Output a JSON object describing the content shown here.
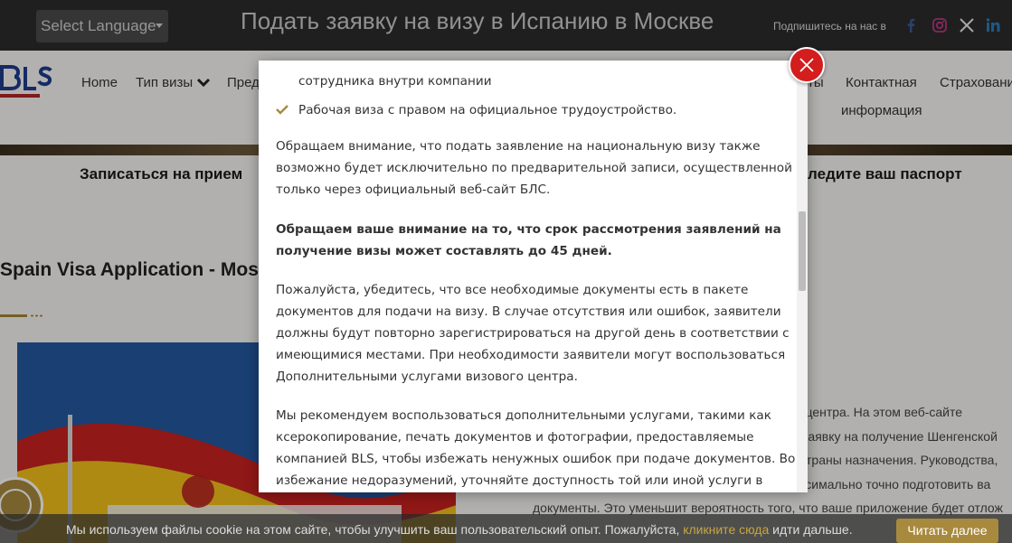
{
  "topbar": {
    "language_select": "Select Language",
    "title": "Подать заявку на визу в Испанию в Москве",
    "subscribe_label": "Подпишитесь на нас в",
    "social_icons": [
      "facebook-icon",
      "instagram-icon",
      "x-icon",
      "linkedin-icon"
    ]
  },
  "nav": {
    "items": [
      {
        "label": "Home"
      },
      {
        "label": "Тип визы"
      },
      {
        "label": "Пред"
      },
      {
        "label": "ты"
      },
      {
        "label_line1": "Контактная",
        "label_line2": "информация"
      },
      {
        "label": "Страховани"
      }
    ]
  },
  "banner": {
    "left_label": "Записаться на прием",
    "right_label": "ледите ваш паспорт"
  },
  "page": {
    "heading": "Spain Visa Application - Mosco",
    "right_text_lines": [
      "го центра. На этом веб-сайте",
      "заявку на получение Шенгенской",
      "страны назначения. Руководства,",
      "ксимально точно подготовить ва",
      "документы. Это уменьшит вероятность того, что ваше приложение будет отлож"
    ]
  },
  "modal": {
    "partial_top_line": "сотрудника внутри компании",
    "check_item": "Рабочая виза с правом на официальное трудоустройство.",
    "para1_lines": [
      "Обращаем внимание, что подать заявление на национальную визу также",
      "возможно будет исключительно по предварительной записи, осуществленной",
      "только через официальный веб-сайт БЛС."
    ],
    "para2_lines": [
      "Обращаем ваше внимание на то, что срок рассмотрения заявлений на",
      "получение визы может составлять до 45 дней."
    ],
    "para3_lines": [
      "Пожалуйста, убедитесь, что все необходимые документы есть в пакете",
      "документов для подачи на визу. В случае отсутствия или ошибок, заявители",
      "должны будут повторно зарегистрироваться на другой день в соответствии с",
      "имеющимися местами. При необходимости заявители могут воспользоваться",
      "Дополнительными услугами визового центра."
    ],
    "para4_lines": [
      "Мы рекомендуем воспользоваться дополнительными услугами, такими как",
      "ксерокопирование, печать документов и фотографии, предоставляемые",
      "компанией BLS, чтобы избежать ненужных ошибок при подаче документов. Во",
      "избежание недоразумений, уточняйте доступность той или иной услуги в"
    ]
  },
  "cookie": {
    "text": "Мы используем файлы cookie на этом сайте, чтобы улучшить ваш пользовательский опыт. Пожалуйста,",
    "link": "кликните сюда",
    "text_after": "идти дальше.",
    "button": "Читать далее"
  },
  "colors": {
    "accent_gold": "#a88a3e",
    "close_red": "#d41d1d",
    "topbar": "#2b2b2b"
  }
}
